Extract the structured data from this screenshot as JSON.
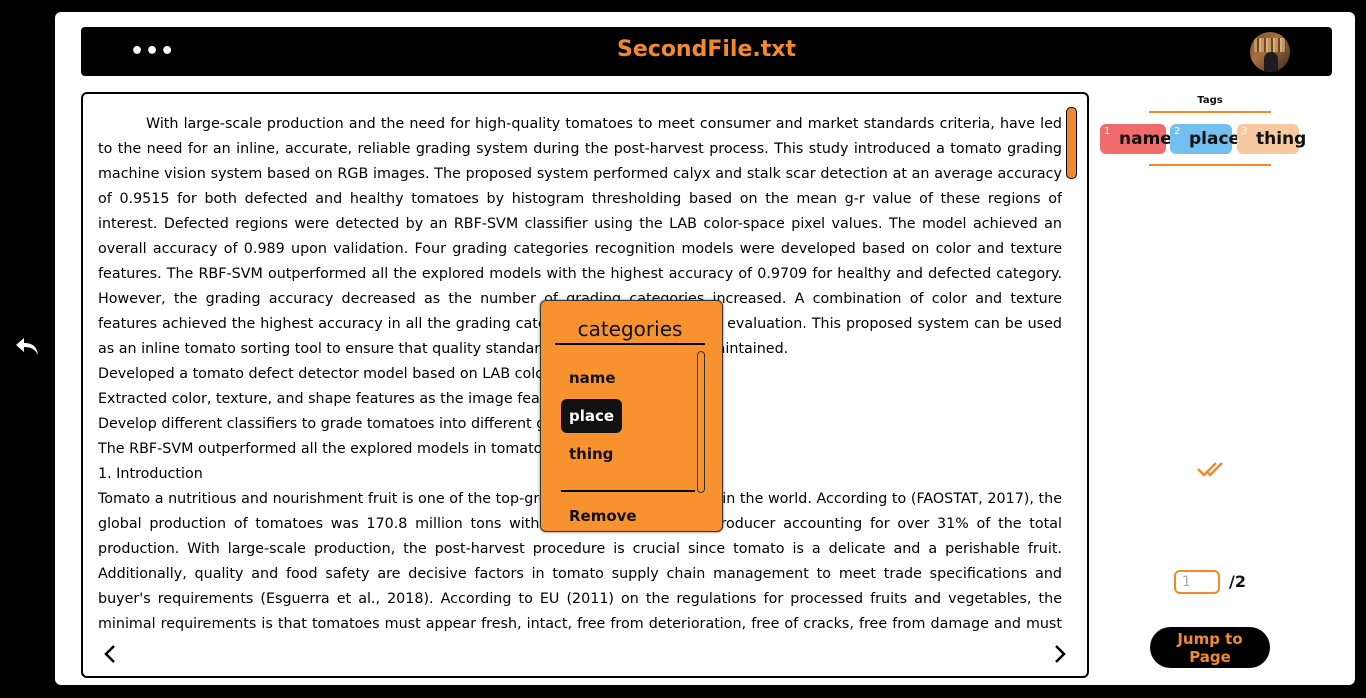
{
  "header": {
    "title": "SecondFile.txt",
    "menu_icon": "ellipsis-icon",
    "menu_symbol": "•••"
  },
  "navigation": {
    "back_icon": "undo-arrow-icon",
    "prev_icon": "chevron-left-icon",
    "next_icon": "chevron-right-icon"
  },
  "document": {
    "paragraphs": [
      "With large-scale production and the need for high-quality tomatoes to meet consumer and market standards criteria, have led to the need for an inline, accurate, reliable grading system during the post-harvest process. This study introduced a tomato grading machine vision system based on RGB images. The proposed system performed calyx and stalk scar detection at an average accuracy of 0.9515 for both defected and healthy tomatoes by histogram thresholding based on the mean g-r value of these regions of interest. Defected regions were detected by an RBF-SVM classifier using the LAB color-space pixel values. The model achieved an overall accuracy of 0.989 upon validation. Four grading categories recognition models were developed based on color and texture features. The RBF-SVM outperformed all the explored models with the highest accuracy of 0.9709 for healthy and defected category. However, the grading accuracy decreased as the number of grading categories increased. A combination of color and texture features achieved the highest accuracy in all the grading categories in image features evaluation. This proposed system can be used as an inline tomato sorting tool to ensure that quality standards are adhered to and maintained.",
      "Developed a tomato defect detector model based on LAB color space.",
      "Extracted color, texture, and shape features as the image feature variables.",
      "Develop different classifiers to grade tomatoes into different grading categories",
      "The RBF-SVM outperformed all the explored models in tomato grading categories",
      "1. Introduction",
      "Tomato a nutritious and nourishment fruit is one of the top-grown agricultural produce in the world. According to (FAOSTAT, 2017), the global production of tomatoes was 170.8 million tons with China as the leading producer accounting for over 31% of the total production. With large-scale production, the post-harvest procedure is crucial since tomato is a delicate and a perishable fruit. Additionally, quality and food safety are decisive factors in tomato supply chain management to meet trade specifications and buyer's requirements (Esguerra et al., 2018). According to EU (2011) on the regulations for processed fruits and vegetables, the minimal requirements is that tomatoes must appear fresh, intact, free from deterioration, free of cracks, free from damage and must arrive at"
    ]
  },
  "categories_popup": {
    "title": "categories",
    "items": [
      "name",
      "place",
      "thing"
    ],
    "selected": "place",
    "remove_label": "Remove"
  },
  "tags": {
    "label": "Tags",
    "items": [
      {
        "number": "1",
        "label": "name",
        "color": "#f06b6b"
      },
      {
        "number": "2",
        "label": "place",
        "color": "#72bff0"
      },
      {
        "number": "3",
        "label": "thing",
        "color": "#f6c9a0"
      }
    ]
  },
  "pagination": {
    "placeholder": "1",
    "total": "/2",
    "jump_label": "Jump to Page"
  },
  "colors": {
    "accent": "#f28a2d",
    "background": "#000000",
    "panel": "#ffffff"
  }
}
